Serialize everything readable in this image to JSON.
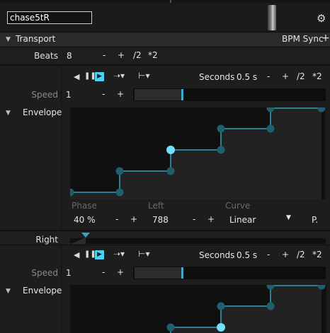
{
  "header": {
    "name_value": "chase5tR",
    "gear_icon": "gear-icon"
  },
  "transport": {
    "title": "Transport",
    "sync_label": "BPM Sync",
    "add_label": "+",
    "beats_label": "Beats",
    "beats_value": "8",
    "minus": "-",
    "plus": "+",
    "div2": "/2",
    "mul2": "*2"
  },
  "sections": [
    {
      "seconds_label": "Seconds",
      "seconds_value": "0.5 s",
      "minus": "-",
      "plus": "+",
      "div2": "/2",
      "mul2": "*2",
      "speed_label": "Speed",
      "speed_value": "1",
      "speed_minus": "-",
      "speed_plus": "+",
      "speed_level": 0.6,
      "envelope_label": "Envelope"
    },
    {
      "seconds_label": "Seconds",
      "seconds_value": "0.5 s",
      "minus": "-",
      "plus": "+",
      "div2": "/2",
      "mul2": "*2",
      "speed_label": "Speed",
      "speed_value": "1",
      "speed_minus": "-",
      "speed_plus": "+",
      "speed_level": 0.6,
      "envelope_label": "Envelope"
    }
  ],
  "params": {
    "phase_label": "Phase",
    "left_label": "Left",
    "curve_label": "Curve",
    "phase_value": "40 %",
    "phase_minus": "-",
    "phase_plus": "+",
    "left_value": "788",
    "left_minus": "-",
    "left_plus": "+",
    "curve_value": "Linear",
    "pin_label": "P."
  },
  "right_label": "Right",
  "colors": {
    "accent": "#50d0f0",
    "envelope_line": "#2f7f94",
    "node": "#1f5f6e",
    "node_selected": "#6fe0ff"
  }
}
